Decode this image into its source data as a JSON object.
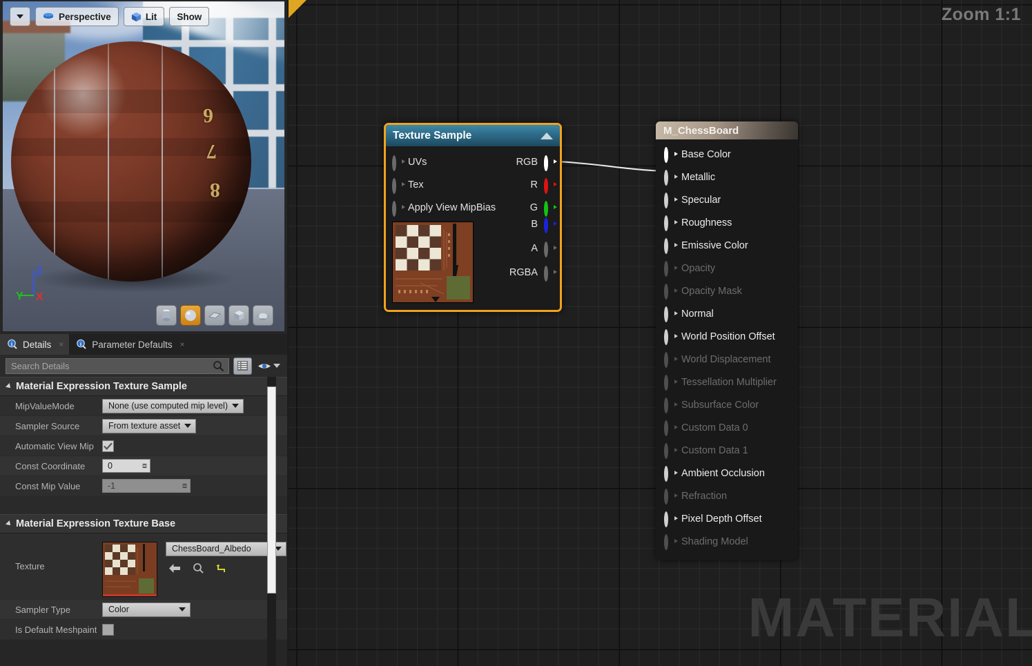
{
  "viewport": {
    "toolbar": {
      "menu_arrow_icon": "chevron-down-icon",
      "perspective_label": "Perspective",
      "perspective_icon": "camera-perspective-icon",
      "lit_label": "Lit",
      "lit_icon": "cube-lit-icon",
      "show_label": "Show"
    },
    "gizmo": {
      "x": "X",
      "y": "Y",
      "z": "Z",
      "x_color": "#e03030",
      "y_color": "#20c020",
      "z_color": "#3355ee"
    },
    "sphere_numbers": [
      "6",
      "7",
      "8"
    ],
    "mesh_buttons": [
      {
        "name": "cylinder-preview",
        "icon": "cylinder-icon",
        "selected": false
      },
      {
        "name": "sphere-preview",
        "icon": "sphere-icon",
        "selected": true
      },
      {
        "name": "plane-preview",
        "icon": "plane-icon",
        "selected": false
      },
      {
        "name": "cube-preview",
        "icon": "cube-icon",
        "selected": false
      },
      {
        "name": "teapot-preview",
        "icon": "teapot-icon",
        "selected": false
      }
    ]
  },
  "details": {
    "tabs": [
      {
        "label": "Details",
        "icon": "info-magnifier-icon",
        "active": true,
        "close": "×"
      },
      {
        "label": "Parameter Defaults",
        "icon": "info-magnifier-icon",
        "active": false,
        "close": "×"
      }
    ],
    "search": {
      "placeholder": "Search Details",
      "value": "",
      "icon": "search-icon"
    },
    "grid_toggle_icon": "grid-view-icon",
    "eye_icon": "eye-icon",
    "eye_chevron_icon": "chevron-down-icon",
    "categories": [
      {
        "title": "Material Expression Texture Sample",
        "rows": [
          {
            "label": "MipValueMode",
            "type": "combo",
            "value": "None (use computed mip level)"
          },
          {
            "label": "Sampler Source",
            "type": "combo",
            "value": "From texture asset"
          },
          {
            "label": "Automatic View Mip",
            "type": "checkbox",
            "value": "checked"
          },
          {
            "label": "Const Coordinate",
            "type": "number",
            "value": "0"
          },
          {
            "label": "Const Mip Value",
            "type": "number-disabled",
            "value": "-1"
          }
        ]
      },
      {
        "title": "Material Expression Texture Base",
        "rows": [
          {
            "label": "Texture",
            "type": "asset",
            "value": "ChessBoard_Albedo",
            "icons": [
              "back-arrow-icon",
              "browse-magnifier-icon",
              "reset-arrow-icon"
            ]
          },
          {
            "label": "Sampler Type",
            "type": "combo",
            "value": "Color"
          },
          {
            "label": "Is Default Meshpaint",
            "type": "checkbox",
            "value": "unchecked"
          }
        ]
      }
    ]
  },
  "graph": {
    "zoom_label": "Zoom 1:1",
    "watermark": "MATERIAL",
    "accent_color": "#f0a31e",
    "nodes": [
      {
        "title": "Texture Sample",
        "collapse_icon": "triangle-up-icon",
        "selected": true,
        "inputs": [
          "UVs",
          "Tex",
          "Apply View MipBias"
        ],
        "outputs": [
          {
            "label": "RGB",
            "color": "white",
            "connected": true
          },
          {
            "label": "R",
            "color": "red",
            "connected": false
          },
          {
            "label": "G",
            "color": "green",
            "connected": false
          },
          {
            "label": "B",
            "color": "blue",
            "connected": false
          },
          {
            "label": "A",
            "color": "gray",
            "connected": false
          },
          {
            "label": "RGBA",
            "color": "gray",
            "connected": false
          }
        ]
      },
      {
        "title": "M_ChessBoard",
        "inputs": [
          {
            "label": "Base Color",
            "enabled": true,
            "connected": true
          },
          {
            "label": "Metallic",
            "enabled": true,
            "connected": false
          },
          {
            "label": "Specular",
            "enabled": true,
            "connected": false
          },
          {
            "label": "Roughness",
            "enabled": true,
            "connected": false
          },
          {
            "label": "Emissive Color",
            "enabled": true,
            "connected": false
          },
          {
            "label": "Opacity",
            "enabled": false,
            "connected": false
          },
          {
            "label": "Opacity Mask",
            "enabled": false,
            "connected": false
          },
          {
            "label": "Normal",
            "enabled": true,
            "connected": false
          },
          {
            "label": "World Position Offset",
            "enabled": true,
            "connected": false
          },
          {
            "label": "World Displacement",
            "enabled": false,
            "connected": false
          },
          {
            "label": "Tessellation Multiplier",
            "enabled": false,
            "connected": false
          },
          {
            "label": "Subsurface Color",
            "enabled": false,
            "connected": false
          },
          {
            "label": "Custom Data 0",
            "enabled": false,
            "connected": false
          },
          {
            "label": "Custom Data 1",
            "enabled": false,
            "connected": false
          },
          {
            "label": "Ambient Occlusion",
            "enabled": true,
            "connected": false
          },
          {
            "label": "Refraction",
            "enabled": false,
            "connected": false
          },
          {
            "label": "Pixel Depth Offset",
            "enabled": true,
            "connected": false
          },
          {
            "label": "Shading Model",
            "enabled": false,
            "connected": false
          }
        ]
      }
    ]
  }
}
